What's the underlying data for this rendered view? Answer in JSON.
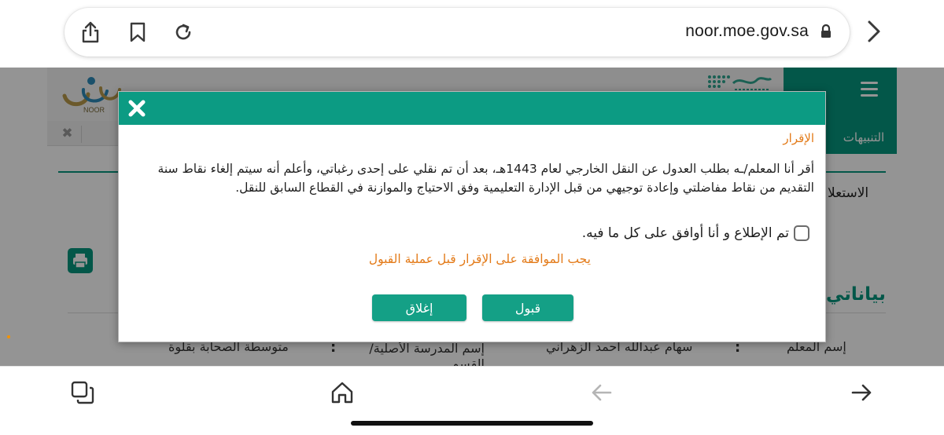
{
  "browser": {
    "url": "noor.moe.gov.sa",
    "toolbar_icons": [
      "share-icon",
      "bookmark-icon",
      "reload-icon",
      "lock-icon",
      "forward-icon"
    ],
    "bottom_icons": [
      "tabs-icon",
      "home-icon",
      "back-icon",
      "forward-icon"
    ]
  },
  "page": {
    "logo_text": "NOOR",
    "alerts_tab": "التنبيهات",
    "side_heading": "الاستعلا",
    "data_heading": "بياناتي",
    "info_rows": {
      "teacher_label": "إسم المعلم",
      "teacher_value": "سهام عبدالله احمد الزهراني",
      "school_label": "إسم المدرسة الأصلية/القسم",
      "school_value": "متوسطة الصحابة بقلوة",
      "colon": ":"
    }
  },
  "modal": {
    "title": "الإقرار",
    "body": "أقر أنا المعلم/ـه بطلب العدول عن النقل الخارجي لعام 1443هـ، بعد أن تم نقلي على إحدى رغباتي، وأعلم أنه سيتم إلغاء نقاط سنة التقديم من نقاط مفاضلتي وإعادة توجيهي من قبل الإدارة التعليمية وفق الاحتياج والموازنة في القطاع السابق للنقل.",
    "agree_label": "تم الإطلاع و أنا أوافق على كل ما فيه.",
    "agree_checked": false,
    "warning": "يجب الموافقة على الإقرار قبل عملية القبول",
    "accept_label": "قبول",
    "close_label": "إغلاق"
  },
  "colors": {
    "accent": "#0c9b83",
    "warning": "#e37a18",
    "button": "#14a086"
  }
}
